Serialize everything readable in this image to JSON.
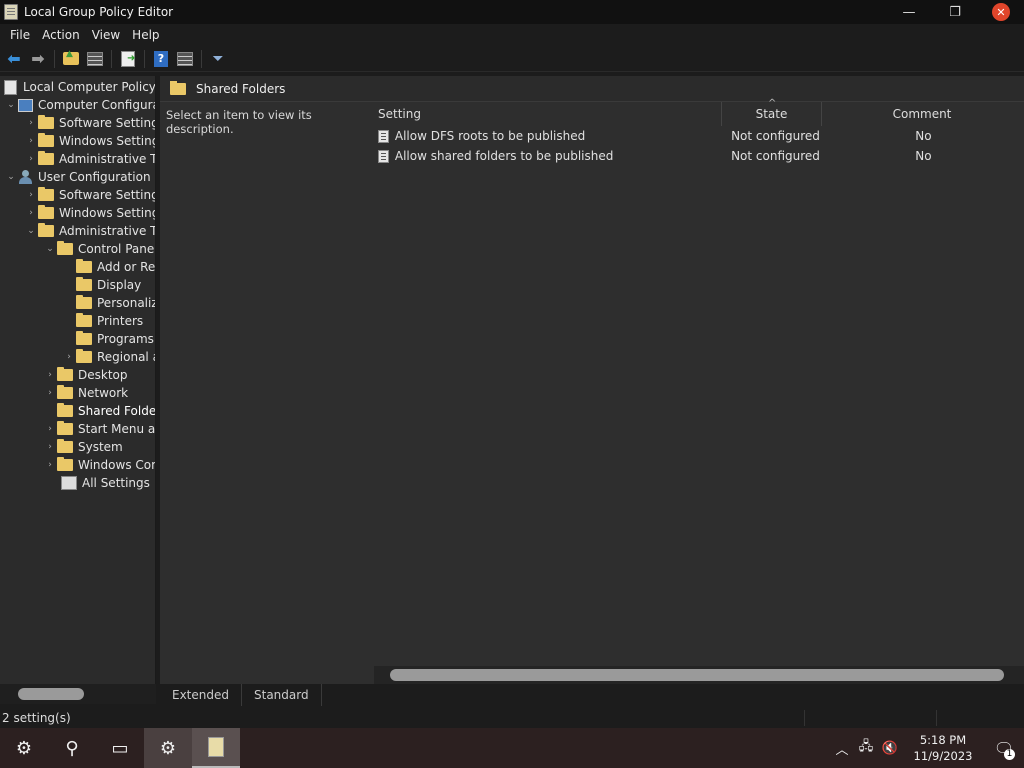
{
  "window": {
    "title": "Local Group Policy Editor",
    "minimize": "—",
    "restore": "❐",
    "close": "✕"
  },
  "menu": [
    "File",
    "Action",
    "View",
    "Help"
  ],
  "tree": {
    "items": [
      {
        "label": "Local Computer Policy",
        "level": 0
      },
      {
        "label": "Computer Configuration",
        "level": 1,
        "expanded": true
      },
      {
        "label": "Software Settings",
        "level": 2,
        "expandable": true
      },
      {
        "label": "Windows Settings",
        "level": 2,
        "expandable": true
      },
      {
        "label": "Administrative Templates",
        "level": 2,
        "expandable": true
      },
      {
        "label": "User Configuration",
        "level": 1,
        "expanded": true
      },
      {
        "label": "Software Settings",
        "level": 2,
        "expandable": true
      },
      {
        "label": "Windows Settings",
        "level": 2,
        "expandable": true
      },
      {
        "label": "Administrative Templates",
        "level": 2,
        "expanded": true
      },
      {
        "label": "Control Panel",
        "level": 3,
        "expanded": true
      },
      {
        "label": "Add or Remove Programs",
        "level": 4
      },
      {
        "label": "Display",
        "level": 4
      },
      {
        "label": "Personalization",
        "level": 4
      },
      {
        "label": "Printers",
        "level": 4
      },
      {
        "label": "Programs",
        "level": 4
      },
      {
        "label": "Regional and Language Options",
        "level": 4,
        "expandable": true
      },
      {
        "label": "Desktop",
        "level": 3,
        "expandable": true
      },
      {
        "label": "Network",
        "level": 3,
        "expandable": true
      },
      {
        "label": "Shared Folders",
        "level": 3,
        "selected": true
      },
      {
        "label": "Start Menu and Taskbar",
        "level": 3,
        "expandable": true
      },
      {
        "label": "System",
        "level": 3,
        "expandable": true
      },
      {
        "label": "Windows Components",
        "level": 3,
        "expandable": true
      },
      {
        "label": "All Settings",
        "level": 3
      }
    ]
  },
  "right": {
    "header_title": "Shared Folders",
    "description": "Select an item to view its description.",
    "columns": {
      "setting": "Setting",
      "state": "State",
      "comment": "Comment"
    },
    "sort_caret": "^",
    "rows": [
      {
        "setting": "Allow DFS roots to be published",
        "state": "Not configured",
        "comment": "No"
      },
      {
        "setting": "Allow shared folders to be published",
        "state": "Not configured",
        "comment": "No"
      }
    ]
  },
  "tabs": [
    "Extended",
    "Standard"
  ],
  "status": {
    "text": "2 setting(s)"
  },
  "taskbar": {
    "clock_time": "5:18 PM",
    "clock_date": "11/9/2023",
    "notification_count": "1"
  }
}
